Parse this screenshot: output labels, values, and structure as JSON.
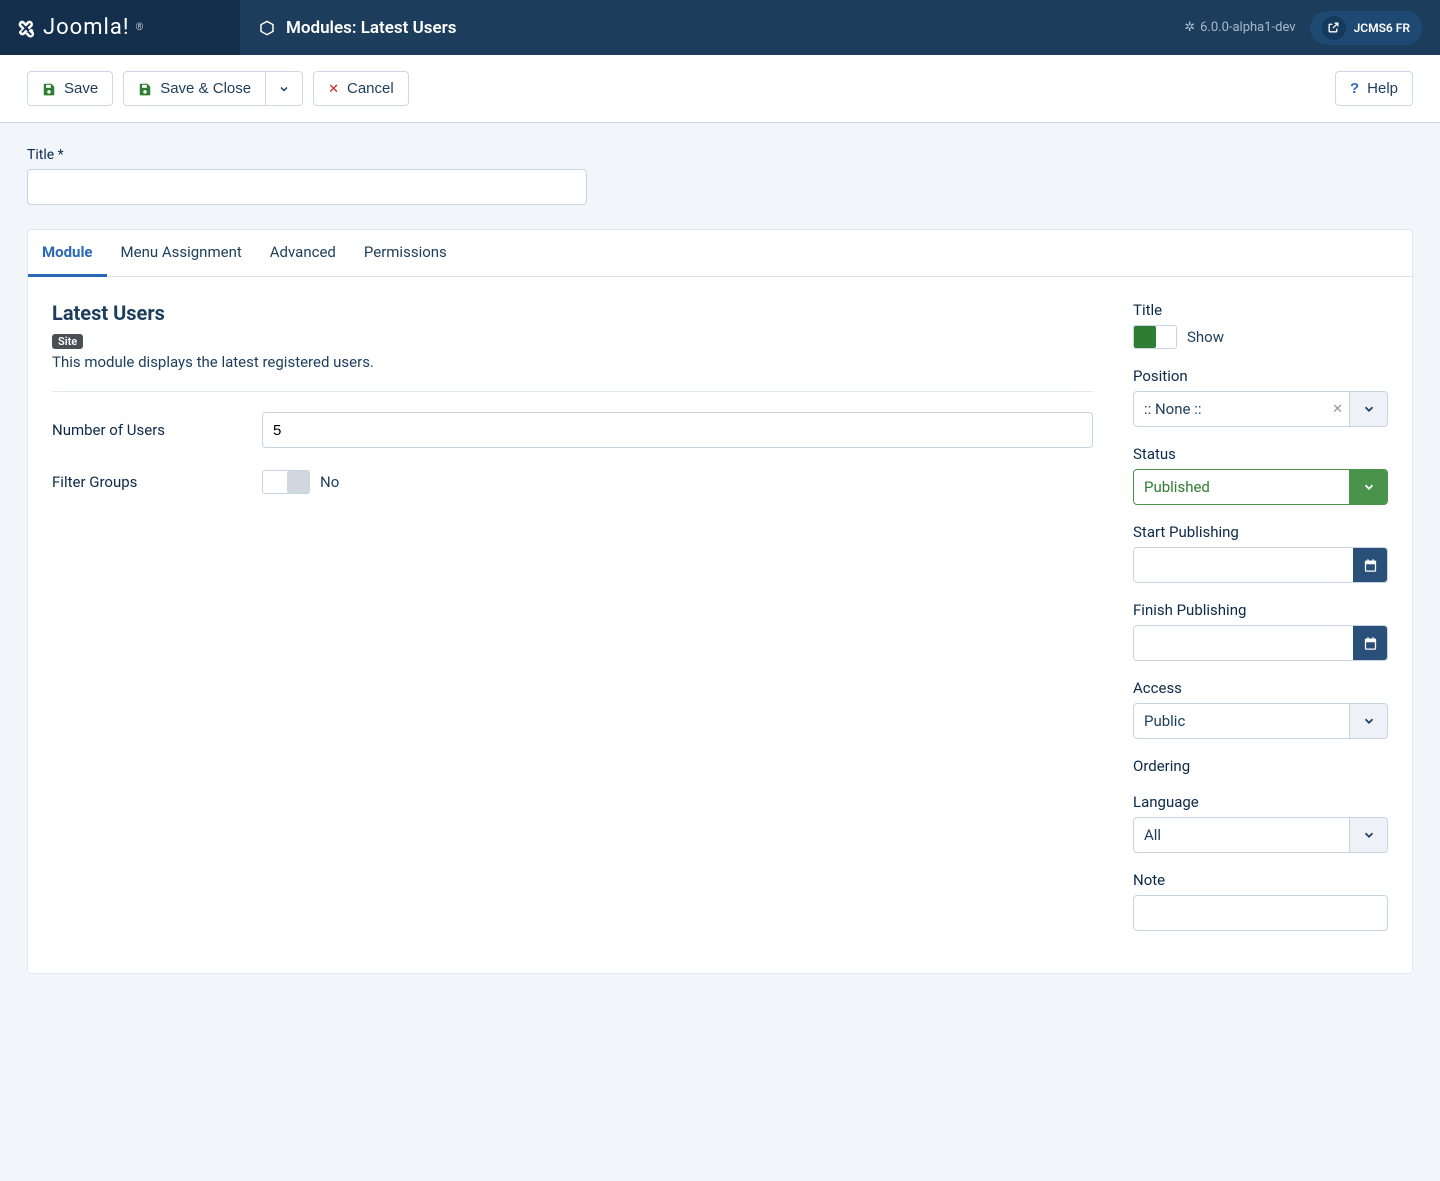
{
  "header": {
    "brand": "Joomla!",
    "page_title": "Modules: Latest Users",
    "version": "6.0.0-alpha1-dev",
    "user": "JCMS6 FR"
  },
  "toolbar": {
    "save": "Save",
    "save_close": "Save & Close",
    "cancel": "Cancel",
    "help": "Help"
  },
  "form": {
    "title_label": "Title *",
    "title_value": ""
  },
  "tabs": {
    "module": "Module",
    "menu_assignment": "Menu Assignment",
    "advanced": "Advanced",
    "permissions": "Permissions"
  },
  "main": {
    "section_title": "Latest Users",
    "badge": "Site",
    "description": "This module displays the latest registered users.",
    "num_users_label": "Number of Users",
    "num_users_value": "5",
    "filter_groups_label": "Filter Groups",
    "filter_groups_value": "No"
  },
  "side": {
    "title_label": "Title",
    "title_toggle": "Show",
    "position_label": "Position",
    "position_value": ":: None ::",
    "status_label": "Status",
    "status_value": "Published",
    "start_pub_label": "Start Publishing",
    "finish_pub_label": "Finish Publishing",
    "access_label": "Access",
    "access_value": "Public",
    "ordering_label": "Ordering",
    "language_label": "Language",
    "language_value": "All",
    "note_label": "Note"
  }
}
